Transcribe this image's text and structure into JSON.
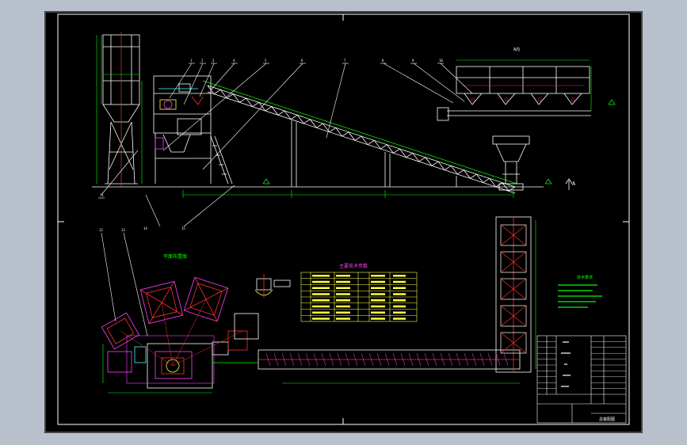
{
  "colors": {
    "background": "#000000",
    "frame": "#ffffff",
    "structure": "#ffffff",
    "conveyor": "#00ff00",
    "dimension": "#00ff00",
    "leader": "#ffffff",
    "accent_red": "#ff3030",
    "accent_magenta": "#ff40ff",
    "accent_yellow": "#ffff40",
    "accent_cyan": "#40ffff",
    "table_border": "#ffff40"
  },
  "icons": [
    "elevation-mark-icon",
    "section-mark-icon"
  ],
  "labels": {
    "plan_view_title": "平面布置图",
    "spec_table_title": "主要技术参数",
    "notes_title": "技术要求",
    "aggregate_view_label": "A向",
    "section_a_label": "A",
    "drawing_title": "总装配图"
  },
  "leaders": {
    "top": [
      "1",
      "2",
      "3",
      "4",
      "5",
      "6",
      "7",
      "8",
      "9",
      "10",
      "11"
    ],
    "bottom": [
      "12",
      "13",
      "14",
      "15"
    ]
  }
}
